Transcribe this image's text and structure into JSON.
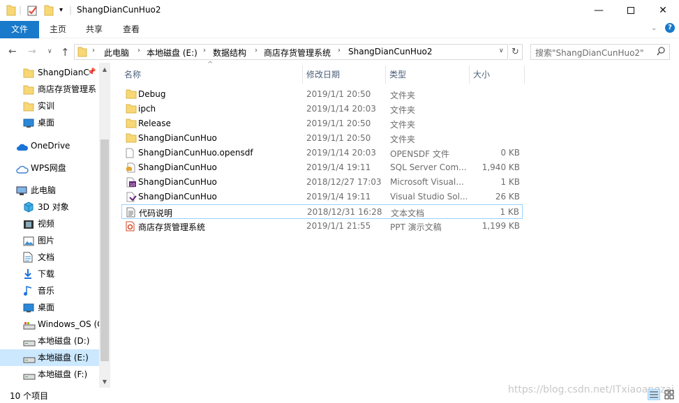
{
  "window": {
    "title": "ShangDianCunHuo2"
  },
  "ribbon": {
    "tabs": [
      "文件",
      "主页",
      "共享",
      "查看"
    ]
  },
  "address": {
    "crumbs": [
      "此电脑",
      "本地磁盘 (E:)",
      "数据结构",
      "商店存货管理系统",
      "ShangDianCunHuo2"
    ],
    "search_placeholder": "搜索\"ShangDianCunHuo2\""
  },
  "nav": {
    "items": [
      {
        "label": "ShangDianC",
        "icon": "folder-icon",
        "pinned": true
      },
      {
        "label": "商店存货管理系",
        "icon": "folder-icon"
      },
      {
        "label": "实训",
        "icon": "folder-icon"
      },
      {
        "label": "桌面",
        "icon": "desktop-icon"
      },
      {
        "label": "OneDrive",
        "icon": "cloud-icon"
      },
      {
        "label": "WPS网盘",
        "icon": "wps-cloud-icon"
      },
      {
        "label": "此电脑",
        "icon": "computer-icon"
      },
      {
        "label": "3D 对象",
        "icon": "3d-objects-icon"
      },
      {
        "label": "视频",
        "icon": "video-icon"
      },
      {
        "label": "图片",
        "icon": "pictures-icon"
      },
      {
        "label": "文档",
        "icon": "documents-icon"
      },
      {
        "label": "下载",
        "icon": "download-icon"
      },
      {
        "label": "音乐",
        "icon": "music-icon"
      },
      {
        "label": "桌面",
        "icon": "desktop-icon"
      },
      {
        "label": "Windows_OS (C",
        "icon": "drive-c-icon"
      },
      {
        "label": "本地磁盘 (D:)",
        "icon": "drive-icon"
      },
      {
        "label": "本地磁盘 (E:)",
        "icon": "drive-icon",
        "selected": true
      },
      {
        "label": "本地磁盘 (F:)",
        "icon": "drive-icon"
      }
    ]
  },
  "columns": {
    "name": "名称",
    "date": "修改日期",
    "type": "类型",
    "size": "大小"
  },
  "files": [
    {
      "name": "Debug",
      "date": "2019/1/1 20:50",
      "type": "文件夹",
      "size": "",
      "icon": "folder-icon"
    },
    {
      "name": "ipch",
      "date": "2019/1/14 20:03",
      "type": "文件夹",
      "size": "",
      "icon": "folder-icon"
    },
    {
      "name": "Release",
      "date": "2019/1/1 20:50",
      "type": "文件夹",
      "size": "",
      "icon": "folder-icon"
    },
    {
      "name": "ShangDianCunHuo",
      "date": "2019/1/1 20:50",
      "type": "文件夹",
      "size": "",
      "icon": "folder-icon"
    },
    {
      "name": "ShangDianCunHuo.opensdf",
      "date": "2019/1/14 20:03",
      "type": "OPENSDF 文件",
      "size": "0 KB",
      "icon": "blank-file-icon"
    },
    {
      "name": "ShangDianCunHuo",
      "date": "2019/1/4 19:11",
      "type": "SQL Server Com...",
      "size": "1,940 KB",
      "icon": "sql-file-icon"
    },
    {
      "name": "ShangDianCunHuo",
      "date": "2018/12/27 17:03",
      "type": "Microsoft Visual...",
      "size": "1 KB",
      "icon": "vs-project-icon"
    },
    {
      "name": "ShangDianCunHuo",
      "date": "2019/1/4 19:11",
      "type": "Visual Studio Sol...",
      "size": "26 KB",
      "icon": "vs-solution-icon"
    },
    {
      "name": "代码说明",
      "date": "2018/12/31 16:28",
      "type": "文本文档",
      "size": "1 KB",
      "icon": "text-file-icon",
      "highlighted": true
    },
    {
      "name": "商店存货管理系统",
      "date": "2019/1/1 21:55",
      "type": "PPT 演示文稿",
      "size": "1,199 KB",
      "icon": "ppt-file-icon"
    }
  ],
  "status": {
    "count": "10 个项目"
  },
  "watermark": "https://blog.csdn.net/ITxiaoangzai",
  "colors": {
    "accent": "#1979ca",
    "selected": "#cce8ff",
    "folder": "#f8d775"
  }
}
